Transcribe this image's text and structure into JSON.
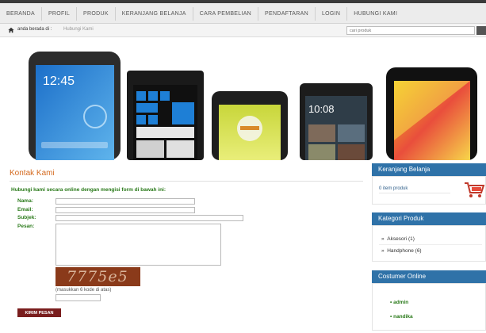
{
  "nav": {
    "items": [
      "BERANDA",
      "PROFIL",
      "PRODUK",
      "KERANJANG BELANJA",
      "CARA PEMBELIAN",
      "PENDAFTARAN",
      "LOGIN",
      "HUBUNGI KAMI"
    ]
  },
  "breadcrumb": {
    "current": "anda berada di :",
    "path": "Hubungi Kami"
  },
  "search": {
    "placeholder": "cari produk"
  },
  "banner": {
    "phone_times": [
      "12:45",
      "10:08"
    ]
  },
  "contact": {
    "title": "Kontak Kami",
    "intro": "Hubungi kami secara online dengan mengisi form di bawah ini:",
    "name_label": "Nama:",
    "email_label": "Email:",
    "subject_label": "Subjek:",
    "message_label": "Pesan:",
    "captcha_text": "7775e5",
    "captcha_hint": "(masukkan 6 kode di atas)",
    "send_label": "KIRIM PESAN"
  },
  "sidebar": {
    "cart": {
      "title": "Keranjang Belanja",
      "text": "0 item produk"
    },
    "categories": {
      "title": "Kategori Produk",
      "items": [
        "Aksesori (1)",
        "Handphone (6)"
      ]
    },
    "online": {
      "title": "Costumer Online",
      "items": [
        "admin",
        "nandika"
      ]
    }
  },
  "colors": {
    "accent_blue": "#2f72a8",
    "title_orange": "#d46a1f",
    "label_green": "#2a7a1a",
    "button_maroon": "#7a1e1e"
  }
}
